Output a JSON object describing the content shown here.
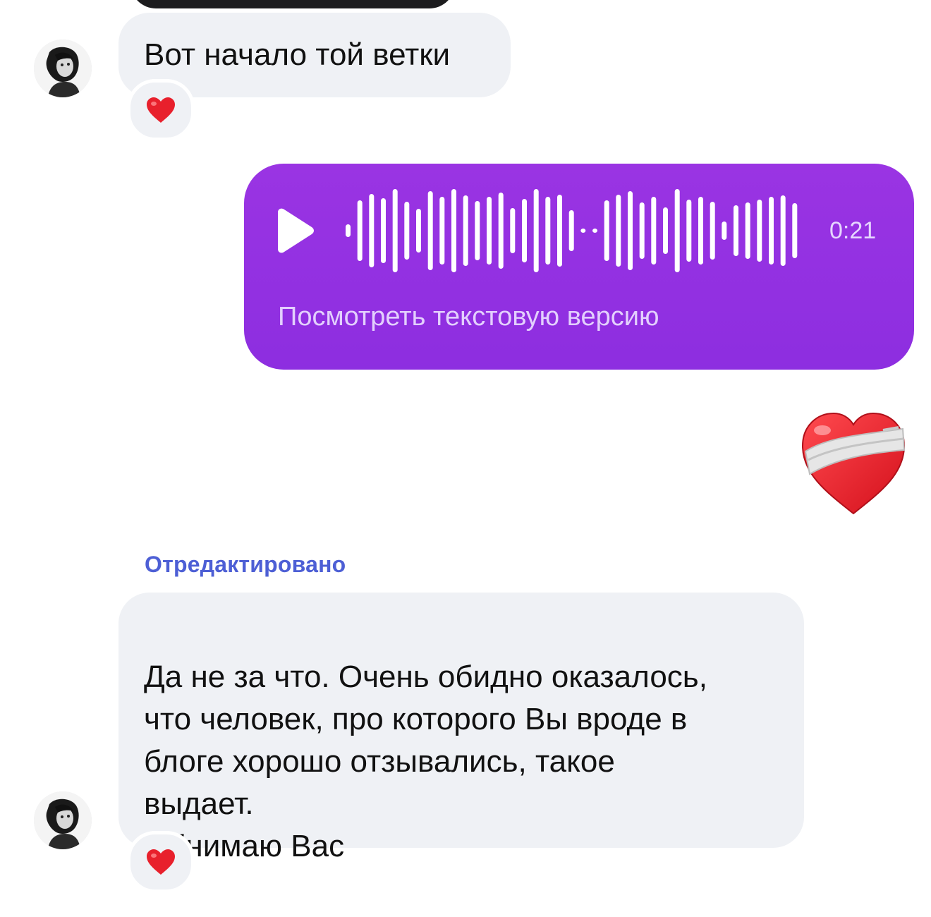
{
  "messages": [
    {
      "text": "Вот начало той ветки",
      "reaction": "red-heart"
    },
    {
      "edited_label": "Отредактировано",
      "text": "Да не за что. Очень обидно оказалось,\nчто человек, про которого Вы вроде в\nблоге хорошо отзывались, такое\nвыдает.\nОбнимаю Вас",
      "reaction": "red-heart"
    }
  ],
  "voice_message": {
    "duration": "0:21",
    "transcript_link": "Посмотреть текстовую версию",
    "accent_color": "#9130e1"
  },
  "sticker": {
    "icon": "mending-heart"
  },
  "colors": {
    "incoming_bubble": "#eff1f5",
    "edited_label": "#4d5fd5",
    "heart": "#e8202c"
  }
}
